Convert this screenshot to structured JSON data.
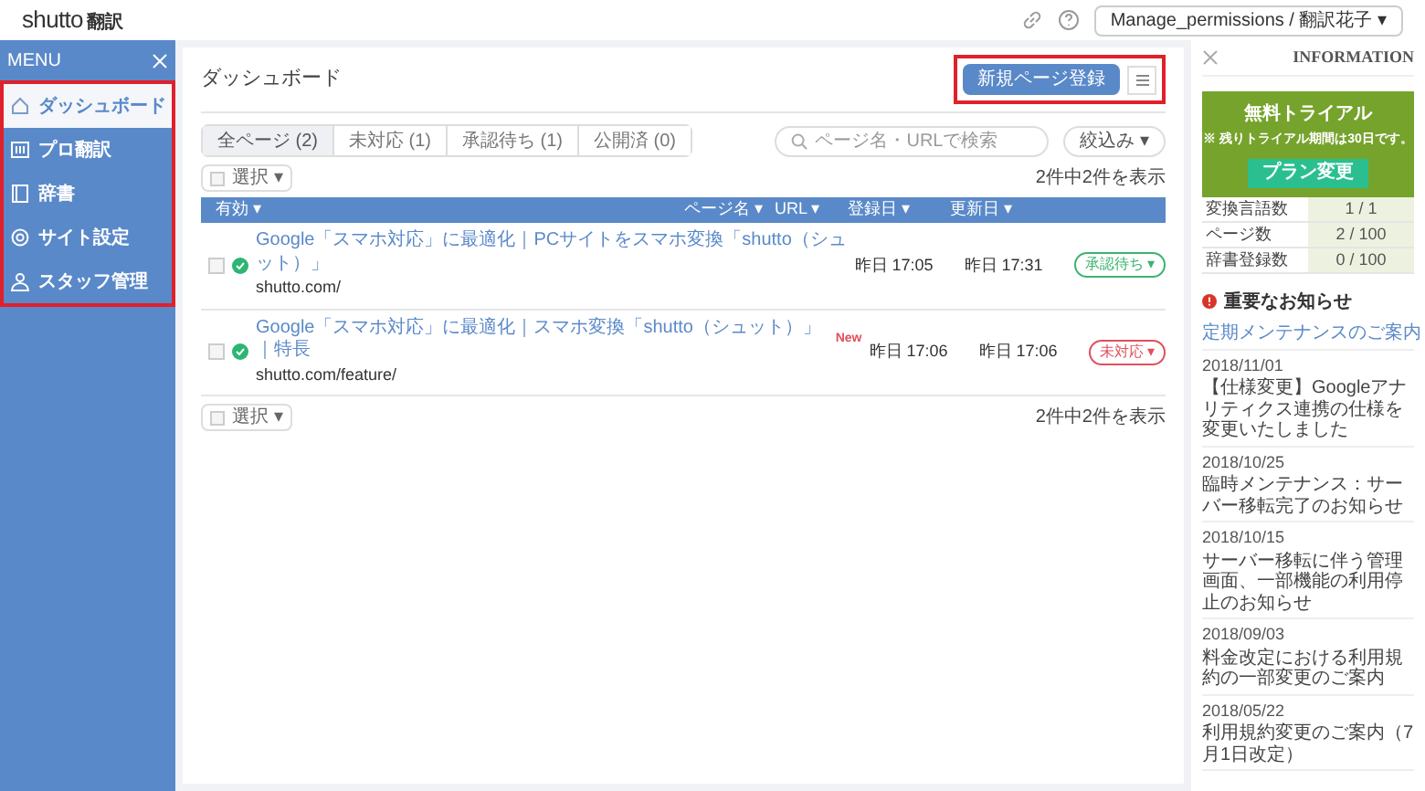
{
  "header": {
    "logo": "shutto",
    "logo_suffix": "翻訳",
    "account": "Manage_permissions / 翻訳花子 ▾"
  },
  "sidebar": {
    "title": "MENU",
    "highlighted": true,
    "items": [
      {
        "label": "ダッシュボード",
        "selected": true,
        "kind": "home"
      },
      {
        "label": "プロ翻訳",
        "selected": false,
        "kind": "grid"
      },
      {
        "label": "辞書",
        "selected": false,
        "kind": "book"
      },
      {
        "label": "サイト設定",
        "selected": false,
        "kind": "gear"
      },
      {
        "label": "スタッフ管理",
        "selected": false,
        "kind": "people"
      }
    ]
  },
  "main": {
    "title": "ダッシュボード",
    "actions_highlighted": true,
    "new_button": "新規ページ登録",
    "filters": [
      {
        "label": "全ページ (2)",
        "selected": true
      },
      {
        "label": "未対応 (1)",
        "selected": false
      },
      {
        "label": "承認待ち (1)",
        "selected": false
      },
      {
        "label": "公開済 (0)",
        "selected": false
      }
    ],
    "search": {
      "placeholder": "ページ名・URLで検索"
    },
    "refine": "絞込み ▾",
    "select_top": "選択 ▾",
    "count_top": "2件中2件を表示",
    "columns": [
      "有効 ▾",
      "ページ名 ▾",
      "URL ▾",
      "登録日 ▾",
      "更新日 ▾"
    ],
    "rows": [
      {
        "checked": false,
        "title": "Google「スマホ対応」に最適化｜PCサイトをスマホ変換「shutto（シュット）」",
        "is_new": false,
        "url": "shutto.com/",
        "created": "昨日 17:05",
        "updated": "昨日 17:31",
        "status": "承認待ち ▾",
        "color": "#3cb371"
      },
      {
        "checked": false,
        "title": "Google「スマホ対応」に最適化｜スマホ変換「shutto（シュット）」｜特長",
        "is_new": true,
        "new_label": "New",
        "url": "shutto.com/feature/",
        "created": "昨日 17:06",
        "updated": "昨日 17:06",
        "status": "未対応 ▾",
        "color": "#e0505a"
      }
    ],
    "select_bottom": "選択 ▾",
    "count_bottom": "2件中2件を表示"
  },
  "info": {
    "title": "INFORMATION",
    "trial": {
      "title": "無料トライアル",
      "note": "※ 残りトライアル期間は30日です。",
      "button": "プラン変更"
    },
    "stats": [
      {
        "label": "変換言語数",
        "value": "1 / 1"
      },
      {
        "label": "ページ数",
        "value": "2 / 100"
      },
      {
        "label": "辞書登録数",
        "value": "0 / 100"
      }
    ],
    "notice_title": "重要なお知らせ",
    "notice_link": "定期メンテナンスのご案内",
    "news": [
      {
        "date": "2018/11/01",
        "text": "【仕様変更】Googleアナリティクス連携の仕様を変更いたしました"
      },
      {
        "date": "2018/10/25",
        "text": "臨時メンテナンス：サーバー移転完了のお知らせ"
      },
      {
        "date": "2018/10/15",
        "text": "サーバー移転に伴う管理画面、一部機能の利用停止のお知らせ"
      },
      {
        "date": "2018/09/03",
        "text": "料金改定における利用規約の一部変更のご案内"
      },
      {
        "date": "2018/05/22",
        "text": "利用規約変更のご案内（7月1日改定）"
      }
    ]
  }
}
